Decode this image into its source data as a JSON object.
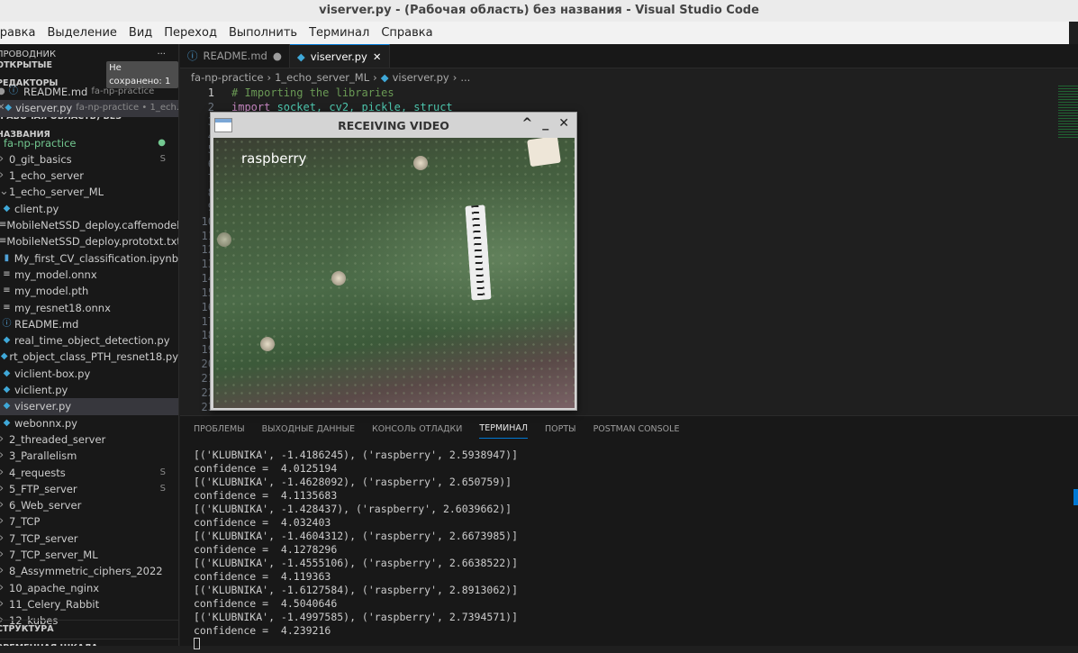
{
  "window": {
    "title": "viserver.py - (Рабочая область) без названия - Visual Studio Code"
  },
  "menu": [
    "Правка",
    "Выделение",
    "Вид",
    "Переход",
    "Выполнить",
    "Терминал",
    "Справка"
  ],
  "sidebar": {
    "title": "ПРОВОДНИК",
    "more": "···",
    "open_editors": {
      "label": "ОТКРЫТЫЕ РЕДАКТОРЫ",
      "badge": "Не сохранено: 1",
      "items": [
        {
          "name": "README.md",
          "desc": "fa-np-practice",
          "icon": "info-icon",
          "mark": "●"
        },
        {
          "name": "viserver.py",
          "desc": "fa-np-practice • 1_ech...",
          "icon": "python-icon",
          "mark": "✕"
        }
      ]
    },
    "workspace": "(РАБОЧАЯ ОБЛАСТЬ) БЕЗ НАЗВАНИЯ",
    "root": {
      "name": "fa-np-practice",
      "status": "●"
    },
    "items": [
      {
        "name": "0_git_basics",
        "type": "folder",
        "status": "S"
      },
      {
        "name": "1_echo_server",
        "type": "folder"
      },
      {
        "name": "1_echo_server_ML",
        "type": "folder-open"
      },
      {
        "name": "client.py",
        "type": "py"
      },
      {
        "name": "MobileNetSSD_deploy.caffemodel",
        "type": "file"
      },
      {
        "name": "MobileNetSSD_deploy.prototxt.txt",
        "type": "file"
      },
      {
        "name": "My_first_CV_classification.ipynb",
        "type": "nb"
      },
      {
        "name": "my_model.onnx",
        "type": "file"
      },
      {
        "name": "my_model.pth",
        "type": "file"
      },
      {
        "name": "my_resnet18.onnx",
        "type": "file"
      },
      {
        "name": "README.md",
        "type": "info"
      },
      {
        "name": "real_time_object_detection.py",
        "type": "py"
      },
      {
        "name": "rt_object_class_PTH_resnet18.py",
        "type": "py"
      },
      {
        "name": "viclient-box.py",
        "type": "py"
      },
      {
        "name": "viclient.py",
        "type": "py"
      },
      {
        "name": "viserver.py",
        "type": "py",
        "selected": true
      },
      {
        "name": "webonnx.py",
        "type": "py"
      },
      {
        "name": "2_threaded_server",
        "type": "folder"
      },
      {
        "name": "3_Parallelism",
        "type": "folder"
      },
      {
        "name": "4_requests",
        "type": "folder",
        "status": "S"
      },
      {
        "name": "5_FTP_server",
        "type": "folder",
        "status": "S"
      },
      {
        "name": "6_Web_server",
        "type": "folder"
      },
      {
        "name": "7_TCP",
        "type": "folder"
      },
      {
        "name": "7_TCP_server",
        "type": "folder"
      },
      {
        "name": "7_TCP_server_ML",
        "type": "folder"
      },
      {
        "name": "8_Assymmetric_ciphers_2022",
        "type": "folder"
      },
      {
        "name": "10_apache_nginx",
        "type": "folder"
      },
      {
        "name": "11_Celery_Rabbit",
        "type": "folder"
      },
      {
        "name": "12_kubes",
        "type": "folder"
      }
    ],
    "outline": "СТРУКТУРА",
    "timeline": "ВРЕМЕННАЯ ШКАЛА"
  },
  "tabs": [
    {
      "label": "README.md",
      "icon": "info-icon",
      "mark": "●"
    },
    {
      "label": "viserver.py",
      "icon": "python-icon",
      "mark": "✕",
      "active": true
    }
  ],
  "breadcrumb": [
    "fa-np-practice",
    "1_echo_server_ML",
    "viserver.py",
    "..."
  ],
  "code": {
    "lines": [
      "# Importing the libraries",
      "import socket, cv2, pickle, struct"
    ],
    "line_count": 23
  },
  "video_window": {
    "title": "RECEIVING VIDEO",
    "overlay_label": "raspberry",
    "buttons": [
      "^",
      "_",
      "✕"
    ]
  },
  "panel": {
    "tabs": [
      "ПРОБЛЕМЫ",
      "ВЫХОДНЫЕ ДАННЫЕ",
      "КОНСОЛЬ ОТЛАДКИ",
      "ТЕРМИНАЛ",
      "ПОРТЫ",
      "POSTMAN CONSOLE"
    ],
    "active_tab": "ТЕРМИНАЛ",
    "terminal": [
      "[('KLUBNIKA', -1.4186245), ('raspberry', 2.5938947)]",
      "confidence =  4.0125194",
      "[('KLUBNIKA', -1.4628092), ('raspberry', 2.650759)]",
      "confidence =  4.1135683",
      "[('KLUBNIKA', -1.428437), ('raspberry', 2.6039662)]",
      "confidence =  4.032403",
      "[('KLUBNIKA', -1.4604312), ('raspberry', 2.6673985)]",
      "confidence =  4.1278296",
      "[('KLUBNIKA', -1.4555106), ('raspberry', 2.6638522)]",
      "confidence =  4.119363",
      "[('KLUBNIKA', -1.6127584), ('raspberry', 2.8913062)]",
      "confidence =  4.5040646",
      "[('KLUBNIKA', -1.4997585), ('raspberry', 2.7394571)]",
      "confidence =  4.239216"
    ]
  }
}
